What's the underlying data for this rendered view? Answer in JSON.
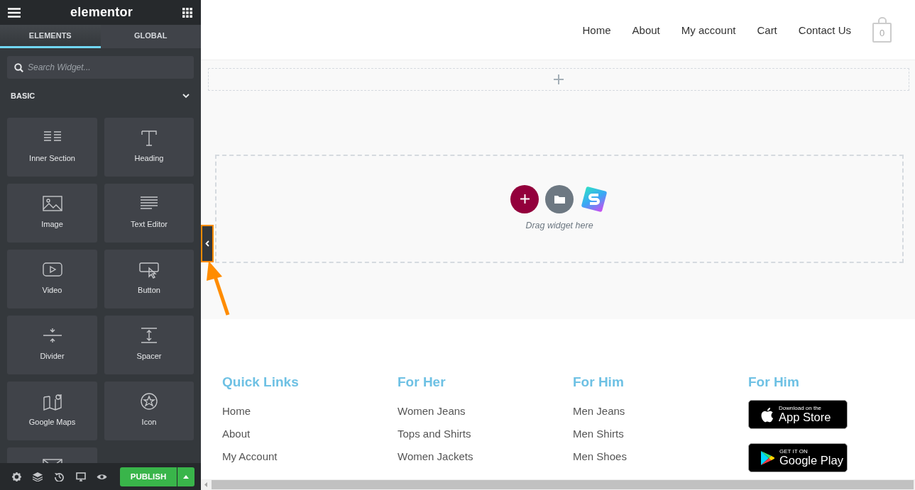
{
  "sidebar": {
    "logo": "elementor",
    "tabs": [
      {
        "label": "ELEMENTS",
        "selected": true
      },
      {
        "label": "GLOBAL",
        "selected": false
      }
    ],
    "search": {
      "placeholder": "Search Widget..."
    },
    "category": {
      "label": "BASIC",
      "expanded": true
    },
    "widgets": [
      {
        "label": "Inner Section"
      },
      {
        "label": "Heading"
      },
      {
        "label": "Image"
      },
      {
        "label": "Text Editor"
      },
      {
        "label": "Video"
      },
      {
        "label": "Button"
      },
      {
        "label": "Divider"
      },
      {
        "label": "Spacer"
      },
      {
        "label": "Google Maps"
      },
      {
        "label": "Icon"
      }
    ],
    "publish": "PUBLISH"
  },
  "nav": {
    "links": [
      "Home",
      "About",
      "My account",
      "Cart",
      "Contact Us"
    ],
    "cart_count": "0"
  },
  "drop_zone": {
    "hint": "Drag widget here"
  },
  "footer": {
    "columns": [
      {
        "kind": "links",
        "title": "Quick Links",
        "links": [
          "Home",
          "About",
          "My Account"
        ]
      },
      {
        "kind": "links",
        "title": "For Her",
        "links": [
          "Women Jeans",
          "Tops and Shirts",
          "Women Jackets"
        ]
      },
      {
        "kind": "links",
        "title": "For Him",
        "links": [
          "Men Jeans",
          "Men Shirts",
          "Men Shoes"
        ]
      },
      {
        "kind": "apps",
        "title": "For Him",
        "badges": [
          {
            "small": "Download on the",
            "big": "App Store"
          },
          {
            "small": "GET IT ON",
            "big": "Google Play"
          }
        ]
      }
    ]
  }
}
